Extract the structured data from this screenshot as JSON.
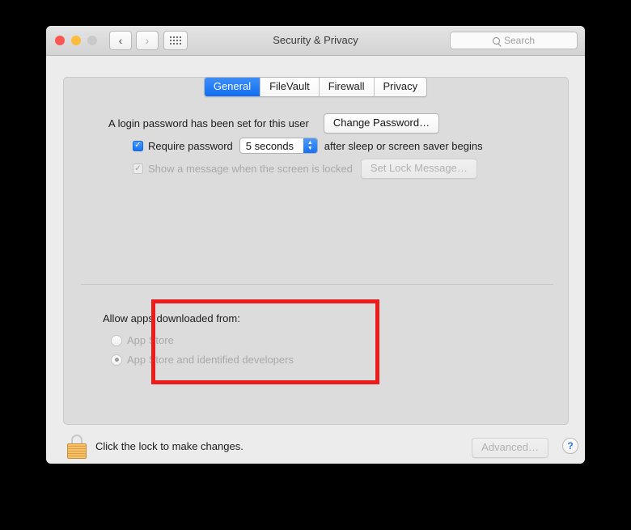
{
  "window": {
    "title": "Security & Privacy",
    "traffic_lights": [
      {
        "name": "close",
        "color": "#fc5753"
      },
      {
        "name": "minimize",
        "color": "#fdbc40"
      },
      {
        "name": "zoom",
        "color": "#c9c9c9"
      }
    ],
    "nav": {
      "back": "‹",
      "forward": "›"
    },
    "grid_button": "show-all",
    "search": {
      "placeholder": "Search",
      "value": ""
    }
  },
  "tabs": [
    {
      "label": "General",
      "active": true
    },
    {
      "label": "FileVault",
      "active": false
    },
    {
      "label": "Firewall",
      "active": false
    },
    {
      "label": "Privacy",
      "active": false
    }
  ],
  "general": {
    "password_status": "A login password has been set for this user",
    "change_password_button": "Change Password…",
    "require_password": {
      "checked": true,
      "label": "Require password",
      "delay_value": "5 seconds",
      "suffix": "after sleep or screen saver begins"
    },
    "lock_message": {
      "checked": true,
      "enabled": false,
      "label": "Show a message when the screen is locked",
      "button": "Set Lock Message…"
    }
  },
  "gatekeeper": {
    "heading": "Allow apps downloaded from:",
    "enabled": false,
    "highlight_color": "#ec1c1c",
    "options": [
      {
        "label": "App Store",
        "selected": false
      },
      {
        "label": "App Store and identified developers",
        "selected": true
      }
    ]
  },
  "footer": {
    "lock_text": "Click the lock to make changes.",
    "lock_state": "locked",
    "advanced_button": "Advanced…",
    "advanced_enabled": false,
    "help_button": "?"
  }
}
